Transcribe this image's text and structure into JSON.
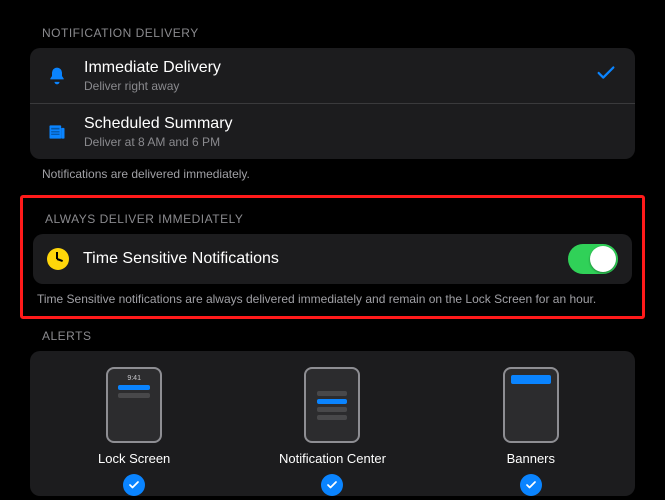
{
  "delivery": {
    "header": "NOTIFICATION DELIVERY",
    "options": [
      {
        "title": "Immediate Delivery",
        "sub": "Deliver right away",
        "selected": true
      },
      {
        "title": "Scheduled Summary",
        "sub": "Deliver at 8 AM and 6 PM",
        "selected": false
      }
    ],
    "footnote": "Notifications are delivered immediately."
  },
  "immediate": {
    "header": "ALWAYS DELIVER IMMEDIATELY",
    "toggle_label": "Time Sensitive Notifications",
    "toggle_on": true,
    "footnote": "Time Sensitive notifications are always delivered immediately and remain on the Lock Screen for an hour."
  },
  "alerts": {
    "header": "ALERTS",
    "options": [
      {
        "label": "Lock Screen",
        "checked": true
      },
      {
        "label": "Notification Center",
        "checked": true
      },
      {
        "label": "Banners",
        "checked": true
      }
    ],
    "preview_time": "9:41"
  },
  "colors": {
    "accent_blue": "#0a84ff",
    "switch_green": "#30d158",
    "clock_yellow": "#ffd60a",
    "highlight_red": "#ff1a1a"
  }
}
